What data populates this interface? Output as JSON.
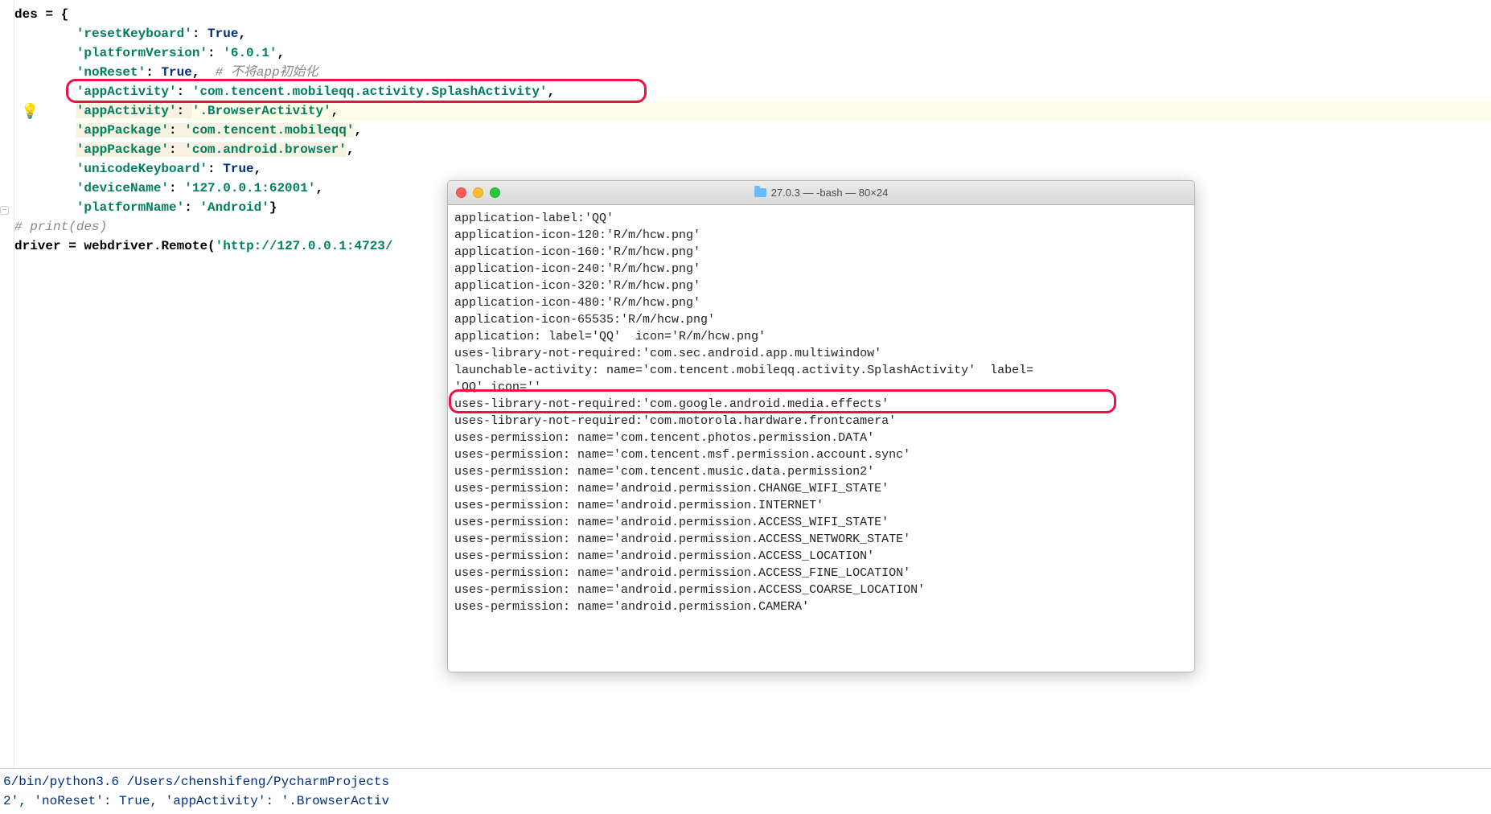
{
  "editor": {
    "var": "des",
    "keys": {
      "resetKeyboard": "'resetKeyboard'",
      "platformVersion": "'platformVersion'",
      "noReset": "'noReset'",
      "appActivity1": "'appActivity'",
      "appActivity2": "'appActivity'",
      "appPackage1": "'appPackage'",
      "appPackage2": "'appPackage'",
      "unicodeKeyboard": "'unicodeKeyboard'",
      "deviceName": "'deviceName'",
      "platformName": "'platformName'"
    },
    "vals": {
      "resetKeyboard": "True",
      "platformVersion": "'6.0.1'",
      "noReset": "True",
      "noResetComment": "# 不将app初始化",
      "appActivity1": "'com.tencent.mobileqq.activity.SplashActivity'",
      "appActivity2": "'.BrowserActivity'",
      "appPackage1": "'com.tencent.mobileqq'",
      "appPackage2": "'com.android.browser'",
      "unicodeKeyboard": "True",
      "deviceName": "'127.0.0.1:62001'",
      "platformName": "'Android'"
    },
    "printComment": "# print(des)",
    "driverLine": {
      "var": "driver",
      "call": "webdriver.Remote(",
      "url": "'http://127.0.0.1:4723/"
    }
  },
  "terminal": {
    "title": "27.0.3 — -bash — 80×24",
    "lines": [
      "application-label:'QQ'",
      "application-icon-120:'R/m/hcw.png'",
      "application-icon-160:'R/m/hcw.png'",
      "application-icon-240:'R/m/hcw.png'",
      "application-icon-320:'R/m/hcw.png'",
      "application-icon-480:'R/m/hcw.png'",
      "application-icon-65535:'R/m/hcw.png'",
      "application: label='QQ'  icon='R/m/hcw.png'",
      "uses-library-not-required:'com.sec.android.app.multiwindow'",
      "launchable-activity: name='com.tencent.mobileqq.activity.SplashActivity'  label=",
      "'QQ' icon=''",
      "uses-library-not-required:'com.google.android.media.effects'",
      "uses-library-not-required:'com.motorola.hardware.frontcamera'",
      "uses-permission: name='com.tencent.photos.permission.DATA'",
      "uses-permission: name='com.tencent.msf.permission.account.sync'",
      "uses-permission: name='com.tencent.music.data.permission2'",
      "uses-permission: name='android.permission.CHANGE_WIFI_STATE'",
      "uses-permission: name='android.permission.INTERNET'",
      "uses-permission: name='android.permission.ACCESS_WIFI_STATE'",
      "uses-permission: name='android.permission.ACCESS_NETWORK_STATE'",
      "uses-permission: name='android.permission.ACCESS_LOCATION'",
      "uses-permission: name='android.permission.ACCESS_FINE_LOCATION'",
      "uses-permission: name='android.permission.ACCESS_COARSE_LOCATION'",
      "uses-permission: name='android.permission.CAMERA'"
    ]
  },
  "bottomStrip": {
    "line1": "6/bin/python3.6 /Users/chenshifeng/PycharmProjects",
    "line2": "2', 'noReset': True, 'appActivity': '.BrowserActiv"
  }
}
